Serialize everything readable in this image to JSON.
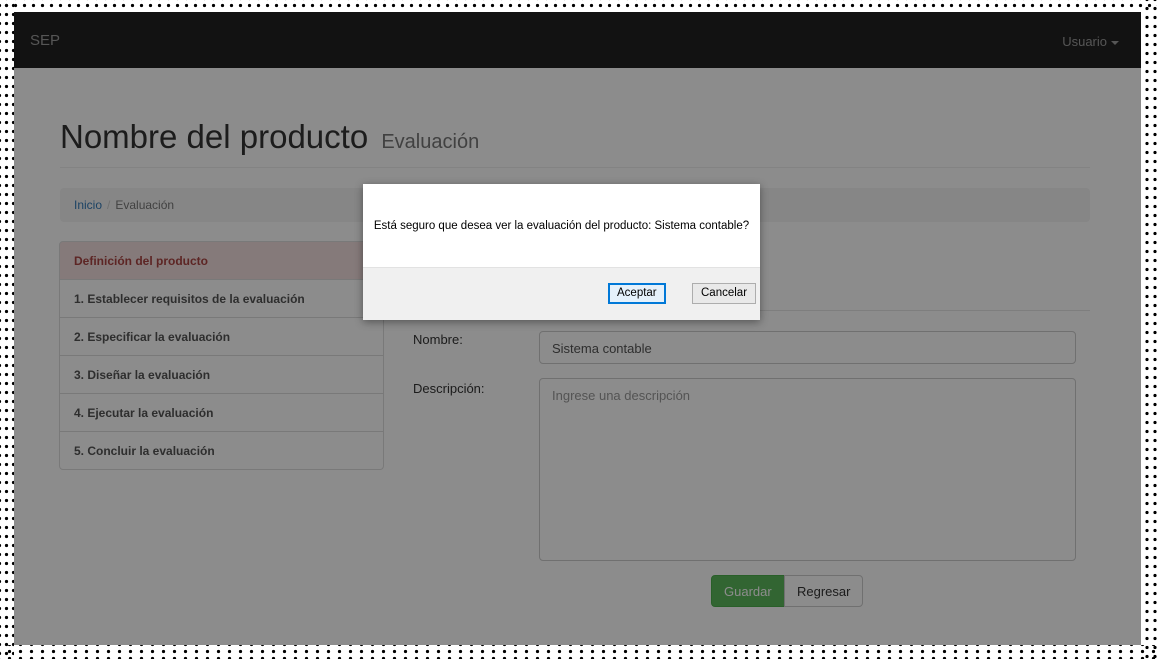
{
  "navbar": {
    "brand": "SEP",
    "user_menu": "Usuario"
  },
  "header": {
    "title": "Nombre del producto",
    "subtitle": "Evaluación"
  },
  "breadcrumb": {
    "home": "Inicio",
    "separator": "/",
    "current": "Evaluación"
  },
  "steps": [
    "Definición del producto",
    "1. Establecer requisitos de la evaluación",
    "2. Especificar la evaluación",
    "3. Diseñar la evaluación",
    "4. Ejecutar la evaluación",
    "5. Concluir la evaluación"
  ],
  "form": {
    "name_label": "Nombre:",
    "name_value": "Sistema contable",
    "description_label": "Descripción:",
    "description_placeholder": "Ingrese una descripción",
    "save_label": "Guardar",
    "back_label": "Regresar"
  },
  "dialog": {
    "message": "Está seguro que desea ver la evaluación del producto: Sistema contable?",
    "ok_label": "Aceptar",
    "cancel_label": "Cancelar"
  },
  "colors": {
    "navbar": "#222222",
    "active_step_bg": "#f2dede",
    "active_step_text": "#a94442",
    "save_button": "#5cb85c",
    "link": "#337ab7"
  },
  "icons": {
    "user_menu_caret": "caret-down-icon"
  }
}
